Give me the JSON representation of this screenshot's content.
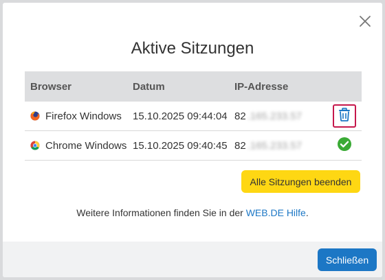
{
  "dialog": {
    "title": "Aktive Sitzungen",
    "close_icon": "close-icon"
  },
  "table": {
    "headers": {
      "browser": "Browser",
      "date": "Datum",
      "ip": "IP-Adresse"
    },
    "rows": [
      {
        "browser": "Firefox Windows",
        "browser_icon": "firefox-icon",
        "date": "15.10.2025 09:44:04",
        "ip_prefix": "82",
        "ip_rest": ".165.233.57",
        "action_icon": "trash-icon",
        "action_color": "#1c77c5"
      },
      {
        "browser": "Chrome Windows",
        "browser_icon": "chrome-icon",
        "date": "15.10.2025 09:40:45",
        "ip_prefix": "82",
        "ip_rest": ".165.233.57",
        "action_icon": "check-circle-icon",
        "action_color": "#3aaa35"
      }
    ]
  },
  "buttons": {
    "end_all": "Alle Sitzungen beenden",
    "close": "Schließen"
  },
  "info": {
    "text": "Weitere Informationen finden Sie in der ",
    "link": "WEB.DE Hilfe",
    "suffix": "."
  },
  "colors": {
    "accent_yellow": "#fed713",
    "accent_blue": "#1c77c5",
    "danger": "#c5174b",
    "success": "#3aaa35"
  }
}
